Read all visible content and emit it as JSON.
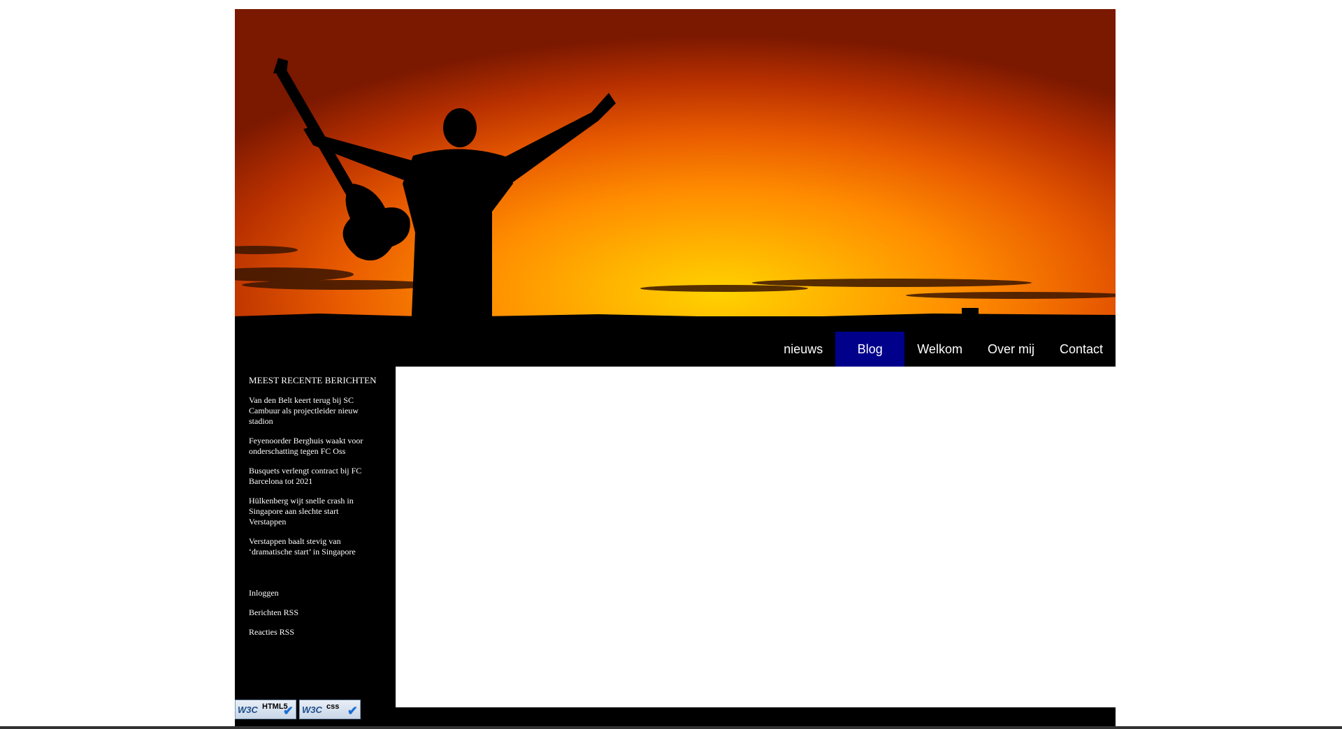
{
  "nav": {
    "items": [
      {
        "label": "nieuws",
        "active": false
      },
      {
        "label": "Blog",
        "active": true
      },
      {
        "label": "Welkom",
        "active": false
      },
      {
        "label": "Over mij",
        "active": false
      },
      {
        "label": "Contact",
        "active": false
      }
    ],
    "active_color": "#00008b"
  },
  "sidebar": {
    "recent_heading": "MEEST RECENTE BERICHTEN",
    "recent_posts": [
      "Van den Belt keert terug bij SC Cambuur als projectleider nieuw stadion",
      "Feyenoorder Berghuis waakt voor onderschatting tegen FC Oss",
      "Busquets verlengt contract bij FC Barcelona tot 2021",
      "Hülkenberg wijt snelle crash in Singapore aan slechte start Verstappen",
      "Verstappen baalt stevig van ‘dramatische start’ in Singapore"
    ],
    "meta_links": [
      "Inloggen",
      "Berichten RSS",
      "Reacties RSS"
    ]
  },
  "badges": [
    {
      "logo": "W3C",
      "kind": "HTML5",
      "icon": "checkmark-icon"
    },
    {
      "logo": "W3C",
      "kind": "css",
      "icon": "checkmark-icon"
    }
  ],
  "colors": {
    "background": "#ffffff",
    "frame": "#000000",
    "text": "#ffffff"
  }
}
